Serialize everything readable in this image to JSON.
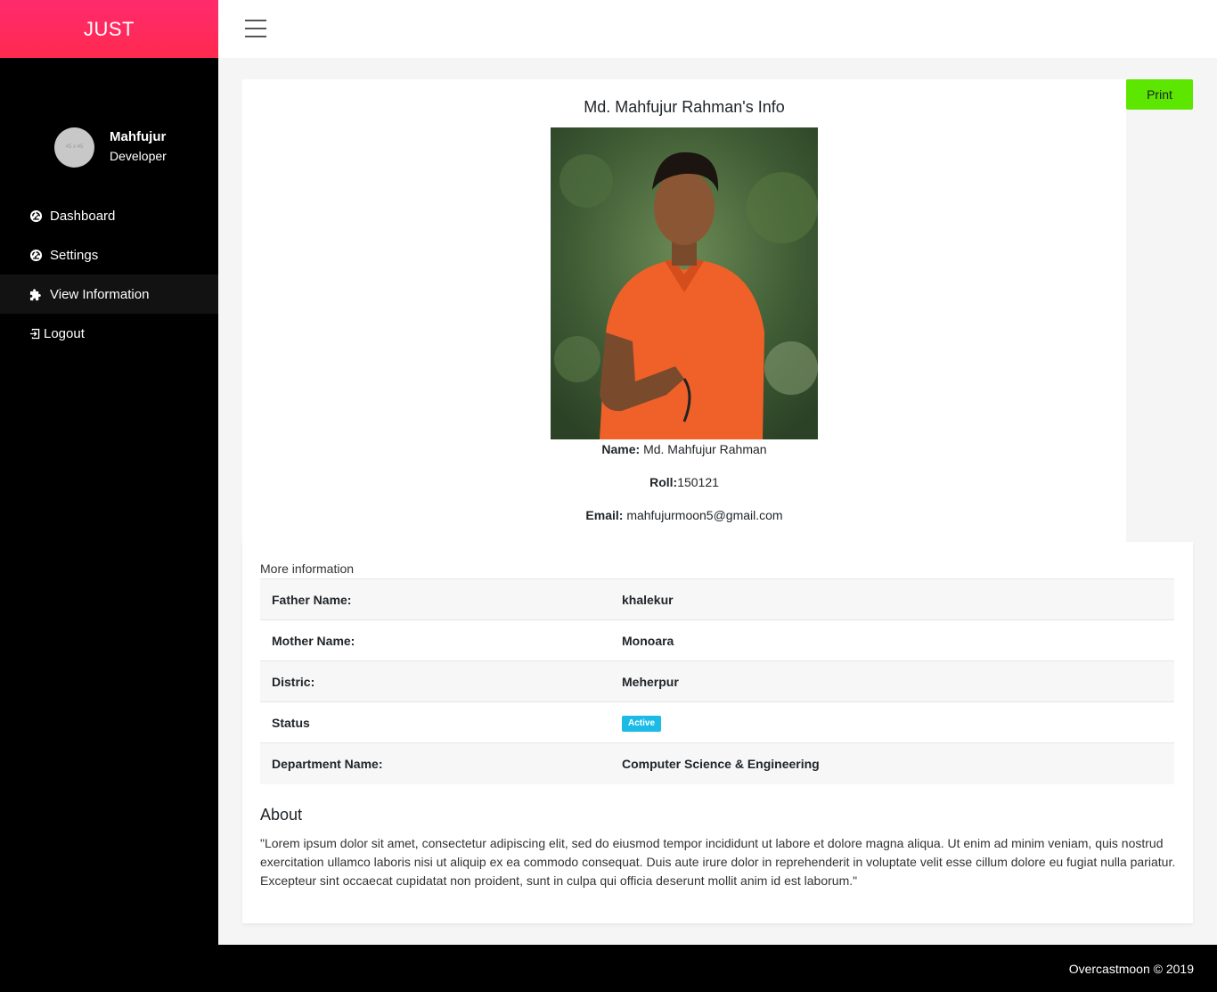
{
  "brand": "JUST",
  "profile": {
    "avatar_text": "45 x 45",
    "name": "Mahfujur",
    "role": "Developer"
  },
  "sidebar": {
    "items": [
      {
        "label": "Dashboard",
        "icon": "dashboard-icon"
      },
      {
        "label": "Settings",
        "icon": "settings-icon"
      },
      {
        "label": "View Information",
        "icon": "puzzle-icon"
      },
      {
        "label": "Logout",
        "icon": "logout-icon"
      }
    ]
  },
  "header": {
    "menu_icon": "hamburger-icon"
  },
  "person": {
    "title": "Md. Mahfujur Rahman's Info",
    "name_label": "Name:",
    "name_value": "Md. Mahfujur Rahman",
    "roll_label": "Roll:",
    "roll_value": "150121",
    "email_label": "Email:",
    "email_value": "mahfujurmoon5@gmail.com"
  },
  "print_label": "Print",
  "more_info": {
    "heading": "More information",
    "rows": [
      {
        "label": "Father Name:",
        "value": "khalekur"
      },
      {
        "label": "Mother Name:",
        "value": "Monoara"
      },
      {
        "label": "Distric:",
        "value": "Meherpur"
      },
      {
        "label": "Status",
        "value": "Active"
      },
      {
        "label": "Department Name:",
        "value": "Computer Science & Engineering"
      }
    ]
  },
  "about": {
    "title": "About",
    "text": "\"Lorem ipsum dolor sit amet, consectetur adipiscing elit, sed do eiusmod tempor incididunt ut labore et dolore magna aliqua. Ut enim ad minim veniam, quis nostrud exercitation ullamco laboris nisi ut aliquip ex ea commodo consequat. Duis aute irure dolor in reprehenderit in voluptate velit esse cillum dolore eu fugiat nulla pariatur. Excepteur sint occaecat cupidatat non proident, sunt in culpa qui officia deserunt mollit anim id est laborum.\""
  },
  "footer": "Overcastmoon © 2019",
  "colors": {
    "brand_gradient": "#ff2a6d",
    "print_button": "#5ce600",
    "status_badge": "#1bbbe6",
    "sidebar_bg": "#000000"
  }
}
